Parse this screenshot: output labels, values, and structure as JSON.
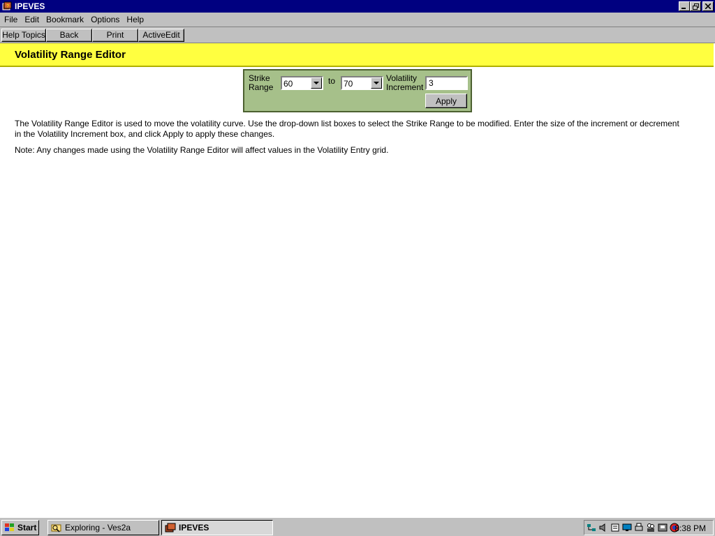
{
  "window": {
    "title": "IPEVES"
  },
  "menu": [
    "File",
    "Edit",
    "Bookmark",
    "Options",
    "Help"
  ],
  "toolbar": [
    "Help Topics",
    "Back",
    "Print",
    "ActiveEdit"
  ],
  "page": {
    "title": "Volatility Range Editor",
    "paragraph1_line1": "The Volatility Range Editor is used to move the volatility curve.  Use the drop-down list boxes to select the Strike Range to be modified.  Enter the size of the increment or decrement",
    "paragraph1_line2": "in the Volatility Increment box, and click Apply to apply these changes.",
    "note": "Note: Any changes made using the Volatility Range Editor will affect values in the Volatility Entry grid."
  },
  "editor": {
    "strike_label_1": "Strike",
    "strike_label_2": "Range",
    "from_value": "60",
    "to_label": "to",
    "to_value": "70",
    "vol_label_1": "Volatility",
    "vol_label_2": "Increment",
    "increment_value": "3",
    "apply_label": "Apply"
  },
  "taskbar": {
    "start_label": "Start",
    "tasks": [
      "Exploring - Ves2a",
      "IPEVES"
    ],
    "clock": "8:38 PM"
  },
  "colors": {
    "title_bar": "#000080",
    "header_band": "#ffff40",
    "panel": "#a6c08a"
  }
}
